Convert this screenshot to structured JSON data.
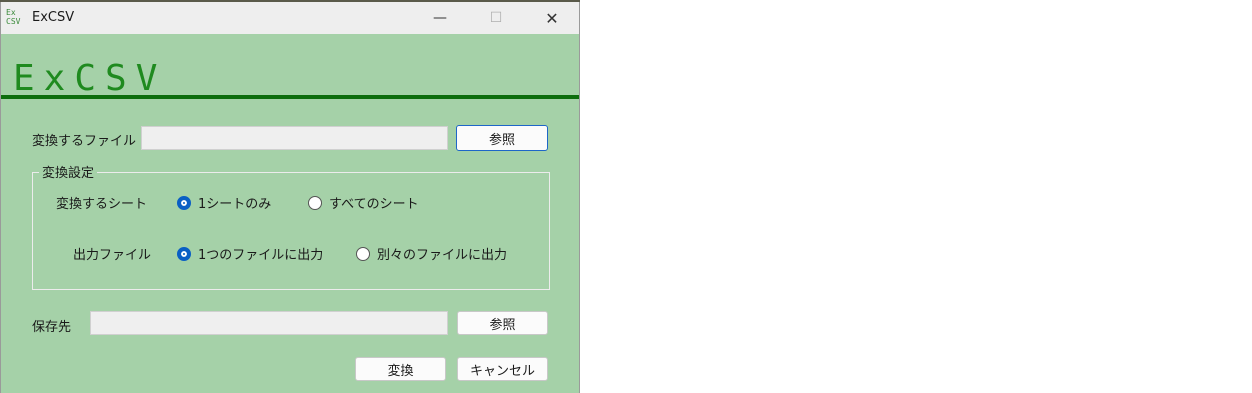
{
  "window": {
    "title": "ExCSV",
    "icon_text_top": "Ex",
    "icon_text_bottom": "CSV",
    "minimize_glyph": "—",
    "maximize_glyph": "☐",
    "close_glyph": "✕"
  },
  "banner": {
    "text": "ExCSV",
    "color": "#1f8a1f",
    "line_color": "#0d6d0d"
  },
  "source_file": {
    "label": "変換するファイル",
    "value": "",
    "browse_label": "参照"
  },
  "settings": {
    "group_label": "変換設定",
    "sheet": {
      "label": "変換するシート",
      "options": [
        "1シートのみ",
        "すべてのシート"
      ],
      "selected": "1シートのみ"
    },
    "output": {
      "label": "出力ファイル",
      "options": [
        "1つのファイルに出力",
        "別々のファイルに出力"
      ],
      "selected": "1つのファイルに出力"
    }
  },
  "destination": {
    "label": "保存先",
    "value": "",
    "browse_label": "参照"
  },
  "actions": {
    "convert_label": "変換",
    "cancel_label": "キャンセル"
  },
  "colors": {
    "window_background": "#a5d1a8",
    "radio_accent": "#0a5fc4"
  }
}
